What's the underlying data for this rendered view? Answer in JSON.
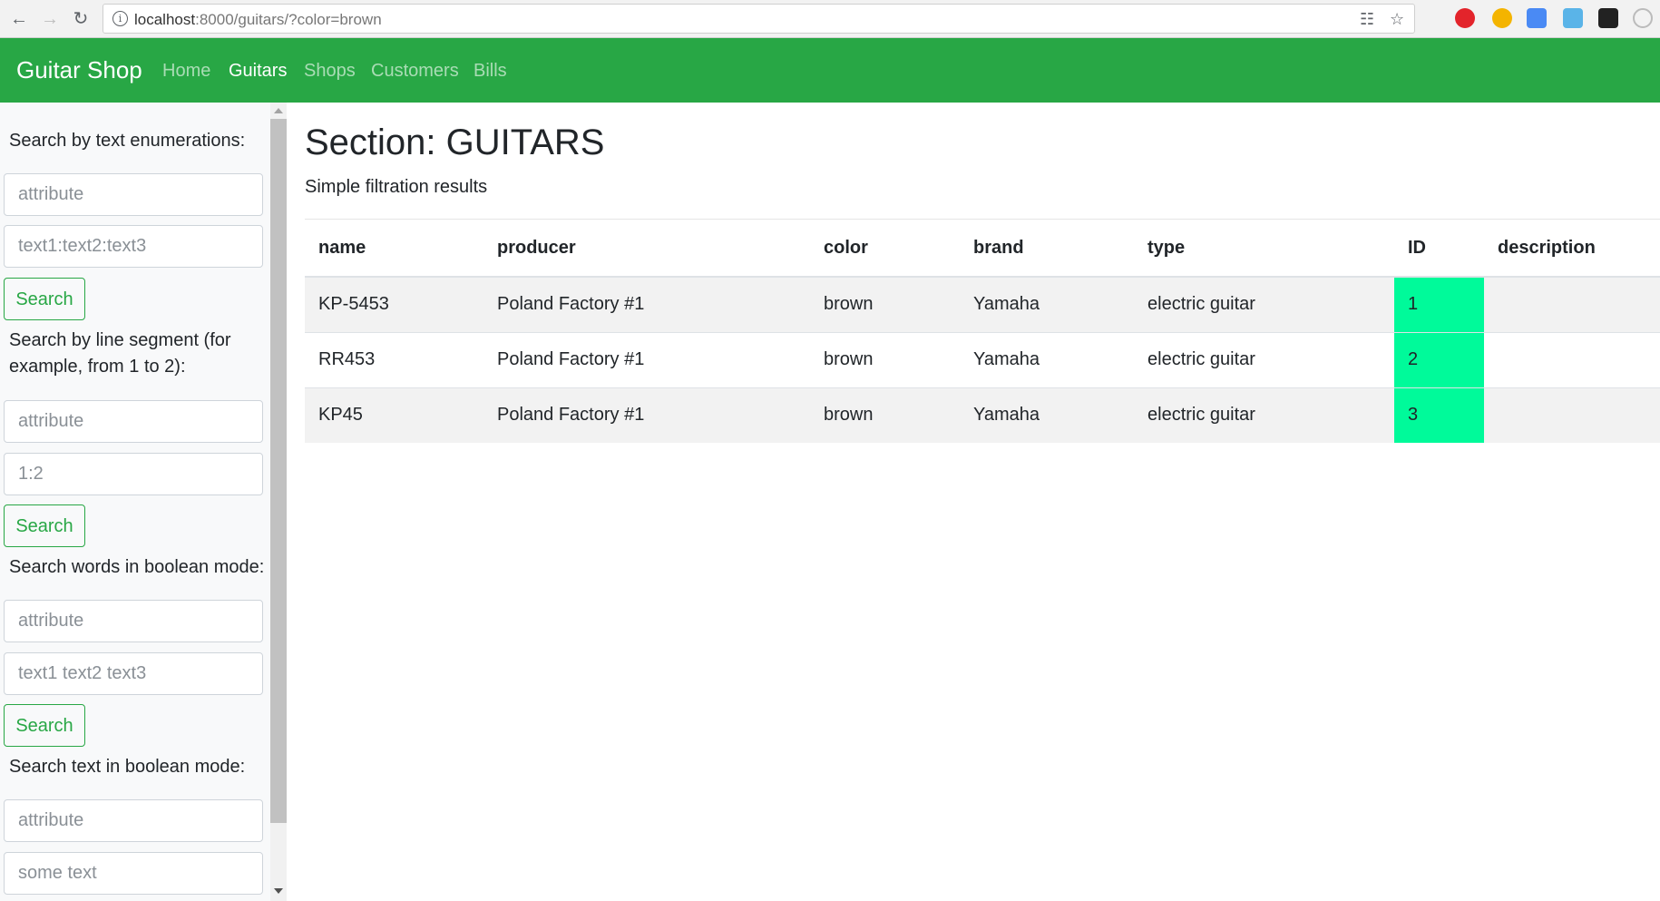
{
  "browser": {
    "url_host": "localhost",
    "url_rest": ":8000/guitars/?color=brown"
  },
  "navbar": {
    "brand": "Guitar Shop",
    "links": [
      {
        "label": "Home",
        "active": false
      },
      {
        "label": "Guitars",
        "active": true
      },
      {
        "label": "Shops",
        "active": false
      },
      {
        "label": "Customers",
        "active": false
      },
      {
        "label": "Bills",
        "active": false
      }
    ]
  },
  "sidebar": {
    "sections": [
      {
        "label": "Search by text enumerations:",
        "placeholder1": "attribute",
        "placeholder2": "text1:text2:text3",
        "button": "Search"
      },
      {
        "label": "Search by line segment (for example, from 1 to 2):",
        "placeholder1": "attribute",
        "placeholder2": "1:2",
        "button": "Search"
      },
      {
        "label": "Search words in boolean mode:",
        "placeholder1": "attribute",
        "placeholder2": "text1 text2 text3",
        "button": "Search"
      },
      {
        "label": "Search text in boolean mode:",
        "placeholder1": "attribute",
        "placeholder2": "some text"
      }
    ]
  },
  "main": {
    "title": "Section: GUITARS",
    "subtitle": "Simple filtration results",
    "columns": [
      "name",
      "producer",
      "color",
      "brand",
      "type",
      "ID",
      "description"
    ],
    "rows": [
      [
        "KP-5453",
        "Poland Factory #1",
        "brown",
        "Yamaha",
        "electric guitar",
        "1",
        ""
      ],
      [
        "RR453",
        "Poland Factory #1",
        "brown",
        "Yamaha",
        "electric guitar",
        "2",
        ""
      ],
      [
        "KP45",
        "Poland Factory #1",
        "brown",
        "Yamaha",
        "electric guitar",
        "3",
        ""
      ]
    ]
  },
  "colors": {
    "navbar": "#28a745",
    "id_highlight": "#00fa9a"
  }
}
